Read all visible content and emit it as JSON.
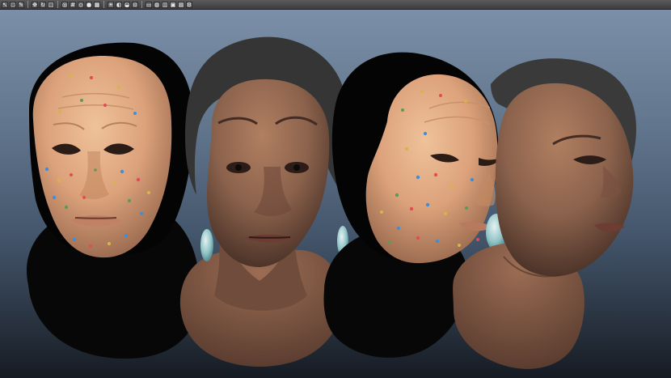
{
  "toolbar": {
    "icons": [
      "select-icon",
      "lasso-icon",
      "paint-icon",
      "move-icon",
      "rotate-icon",
      "scale-icon",
      "camera-icon",
      "grid-icon",
      "wireframe-icon",
      "smooth-shade-icon",
      "texture-icon",
      "light-icon",
      "shadow-icon",
      "isolate-icon",
      "xray-icon",
      "frame-icon",
      "ambient-occlusion-icon",
      "anti-aliasing-icon",
      "resolution-gate-icon",
      "film-gate-icon",
      "settings-icon"
    ]
  },
  "viewport": {
    "name": "perspective-viewport",
    "background": {
      "top": "#7b8fa8",
      "middle": "#44566c",
      "bottom": "#161b23"
    }
  },
  "scene": {
    "models": [
      "front-face-with-markers",
      "front-face-textured",
      "profile-face-with-markers",
      "profile-face-textured"
    ],
    "colors": {
      "skin_light": "#dca27b",
      "skin_dark": "#8b624c",
      "hair": "#3a3a3a",
      "body_black": "#070707",
      "marker_red": "#e34c54",
      "marker_blue": "#3f8ed9",
      "marker_yellow": "#d5b44c",
      "marker_green": "#5d9a58"
    }
  }
}
